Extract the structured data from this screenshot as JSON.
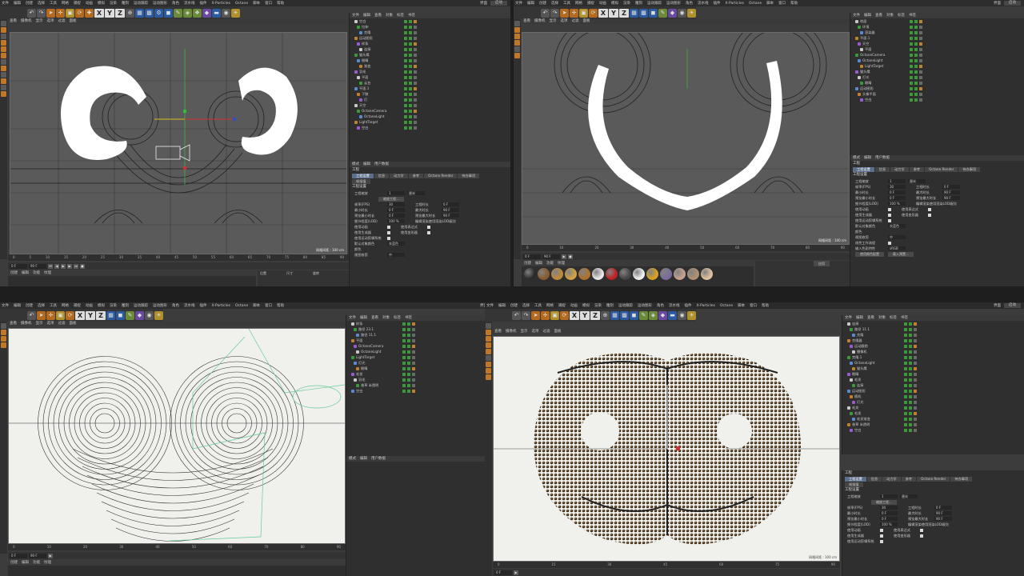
{
  "menu": {
    "items": [
      "文件",
      "编辑",
      "创建",
      "选择",
      "工具",
      "网格",
      "捕捉",
      "动画",
      "模拟",
      "渲染",
      "雕刻",
      "运动跟踪",
      "运动图形",
      "角色",
      "流水线",
      "插件",
      "X-Particles",
      "Octane",
      "脚本",
      "窗口",
      "帮助"
    ],
    "layout_label": "界面",
    "layout_value": "启动"
  },
  "toolbar": {
    "x": "X",
    "y": "Y",
    "z": "Z"
  },
  "viewport": {
    "menu": [
      "查看",
      "摄像机",
      "显示",
      "选项",
      "过滤",
      "面板"
    ],
    "label": "透视视图",
    "grid_info": "网格间距 : 100 cm",
    "grid_info_tr": "网格间距 : 100 cm",
    "grid_info_br": "网格间距 : 100 cm"
  },
  "timeline": {
    "ticks": [
      "0",
      "5",
      "10",
      "15",
      "20",
      "25",
      "30",
      "35",
      "40",
      "45",
      "50",
      "55",
      "60",
      "65",
      "70",
      "75",
      "80",
      "85",
      "90"
    ],
    "start_field": "0 F",
    "end_field": "90 F",
    "frame_label": "0 F"
  },
  "materials": {
    "menu": [
      "创建",
      "编辑",
      "功能",
      "纹理"
    ],
    "swatches": [
      "#2a2a2a",
      "#8a5a2a",
      "#c08a3a",
      "#d4a040",
      "#b0702a",
      "#e8e8e8",
      "#c02020",
      "#444444",
      "#f0f0f0",
      "#d8a020",
      "#7a6a9a",
      "#c8a090",
      "#b09070",
      "#e0c0a0"
    ]
  },
  "coords": {
    "headers": [
      "位置",
      "尺寸",
      "旋转"
    ],
    "rows": [
      [
        "X",
        "0 cm",
        "X",
        "0 cm",
        "H",
        "0°"
      ],
      [
        "Y",
        "0 cm",
        "Y",
        "0 cm",
        "P",
        "0°"
      ],
      [
        "Z",
        "0 cm",
        "Z",
        "0 cm",
        "B",
        "0°"
      ]
    ],
    "apply": "应用"
  },
  "objects": {
    "menu": [
      "文件",
      "编辑",
      "查看",
      "对象",
      "标签",
      "书签"
    ],
    "items_tl": [
      "空白",
      "拉伸",
      "克隆",
      "运动图形",
      "样条",
      "连接",
      "猫头鹰",
      "眼睛",
      "渐变",
      "羽毛",
      "平面",
      "云台",
      "平面.1",
      "下肢",
      "灯",
      "天空",
      "OctaneCamera",
      "OctaneLight",
      "LightTarget",
      "空白"
    ],
    "items_tr": [
      "地面",
      "环境",
      "渲染器",
      "平面.1",
      "天空",
      "平面",
      "OctaneCamera",
      "OctaneLight",
      "LightTarget",
      "猫头鹰",
      "灯光",
      "眼睛",
      "运动图形",
      "头像平面",
      "空白"
    ],
    "items_bl": [
      "样条",
      "路径 23.1",
      "路径 11.1",
      "平面",
      "OctaneCamera",
      "OctaneLight",
      "LightTarget",
      "灯光",
      "眼睛",
      "毛发",
      "羽毛",
      "香草 半透明",
      "空白"
    ],
    "items_br": [
      "连接",
      "路径 11.1",
      "克隆",
      "克隆器",
      "运动跟踪",
      "摄像机",
      "克隆.1",
      "OctaneLight",
      "猫头鹰",
      "眼睛",
      "毛发",
      "连接",
      "运动图形",
      "随机",
      "灯光",
      "毛发",
      "毛发",
      "毛发渐变",
      "香草 半透明",
      "空白"
    ]
  },
  "attributes": {
    "menu": [
      "模式",
      "编辑",
      "用户数据"
    ],
    "object_label": "工程",
    "tabs": [
      "工程设置",
      "信息",
      "动力学",
      "参考",
      "Octane Render",
      "待办事项"
    ],
    "sub_tab": "帧插值",
    "section": "工程设置",
    "scale_label": "工程缩放",
    "scale_value": "1",
    "scale_unit": "厘米",
    "scale_button": "缩放工程...",
    "rows": [
      {
        "l": "帧率(FPS)",
        "v": "30",
        "l2": "工程时长",
        "v2": "0 F"
      },
      {
        "l": "最小时长",
        "v": "0 F",
        "l2": "最大时长",
        "v2": "90 F"
      },
      {
        "l": "预览最小时长",
        "v": "0 F",
        "l2": "预览最大时长",
        "v2": "90 F"
      },
      {
        "l": "细节程度(LOD)",
        "v": "100 %",
        "l2": "编辑渲染使用渲染LOD级别",
        "v2": ""
      }
    ],
    "checks": [
      {
        "l": "使用动画",
        "l2": "使用表达式"
      },
      {
        "l": "使用生成器",
        "l2": "使用变形器"
      },
      {
        "l": "使用运动剪辑系统",
        "l2": ""
      }
    ],
    "default_color_label": "默认对象颜色",
    "default_color_value": "灰蓝色",
    "color_label": "颜色",
    "view_clip_label": "视图修剪",
    "view_clip_value": "中",
    "linear_flow_label": "线性工作流程",
    "input_color_label": "输入色彩特性",
    "input_color_value": "sRGB",
    "use_color_button": "使用颜色配置",
    "load_preset": "载入预置..."
  },
  "colors": {
    "accent_orange": "#c07828",
    "tab_active": "#5b6e8a",
    "bg_panel": "#2f2f2f",
    "bg_viewport_dark": "#5a5a5a",
    "bg_viewport_light": "#f0f0ec"
  }
}
